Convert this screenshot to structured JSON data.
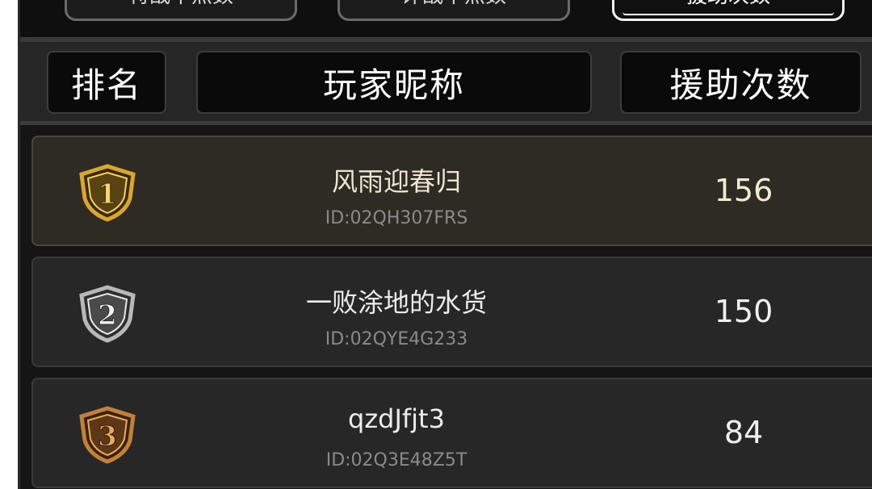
{
  "tabs": [
    {
      "label": "特战中点数",
      "active": false
    },
    {
      "label": "评战中点数",
      "active": false
    },
    {
      "label": "援助次数",
      "active": true
    }
  ],
  "header": {
    "rank": "排名",
    "nickname": "玩家昵称",
    "count": "援助次数"
  },
  "rows": [
    {
      "rank": "1",
      "name": "风雨迎春归",
      "id": "ID:02QH307FRS",
      "count": "156",
      "badge_color": "#d9a72e"
    },
    {
      "rank": "2",
      "name": "一败涂地的水货",
      "id": "ID:02QYE4G233",
      "count": "150",
      "badge_color": "#b8b8b8"
    },
    {
      "rank": "3",
      "name": "qzdJfjt3",
      "id": "ID:02Q3E48Z5T",
      "count": "84",
      "badge_color": "#c2813a"
    }
  ]
}
